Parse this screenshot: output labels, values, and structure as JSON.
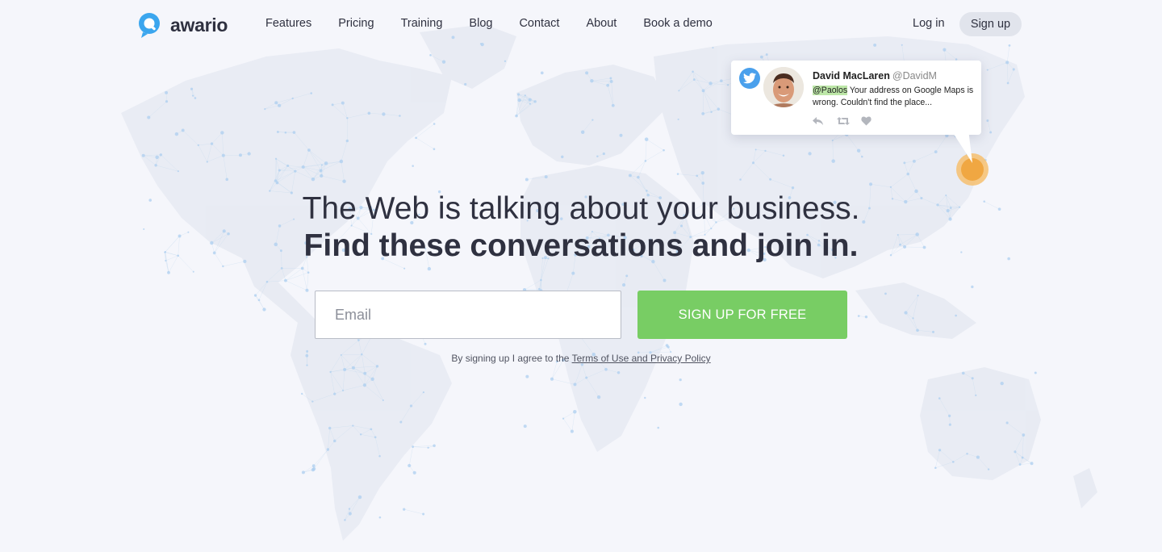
{
  "brand": {
    "name": "awario",
    "logo_icon": "awario-logo-icon",
    "accent": "#3ba6ee"
  },
  "nav": {
    "items": [
      {
        "label": "Features"
      },
      {
        "label": "Pricing"
      },
      {
        "label": "Training"
      },
      {
        "label": "Blog"
      },
      {
        "label": "Contact"
      },
      {
        "label": "About"
      },
      {
        "label": "Book a demo"
      }
    ],
    "login_label": "Log in",
    "signup_label": "Sign up"
  },
  "hero": {
    "headline": "The Web is talking about your business.",
    "subheadline": "Find these conversations and join in."
  },
  "signup_form": {
    "email_placeholder": "Email",
    "cta_label": "SIGN UP FOR FREE",
    "cta_color": "#78cd64",
    "terms_prefix": "By signing up I agree to the ",
    "terms_link": "Terms of Use and Privacy Policy"
  },
  "tweet": {
    "platform_icon": "twitter-bird-icon",
    "author_name": "David MacLaren",
    "author_handle": "@DavidM",
    "mention": "@Paolos",
    "text": " Your address on Google Maps is wrong. Couldn't find the place...",
    "actions": [
      "reply-icon",
      "retweet-icon",
      "like-icon"
    ],
    "pin_color": "#f0a742"
  },
  "background": {
    "map_dot_color": "#a9cdef",
    "map_land_color": "#e9ecf3"
  }
}
